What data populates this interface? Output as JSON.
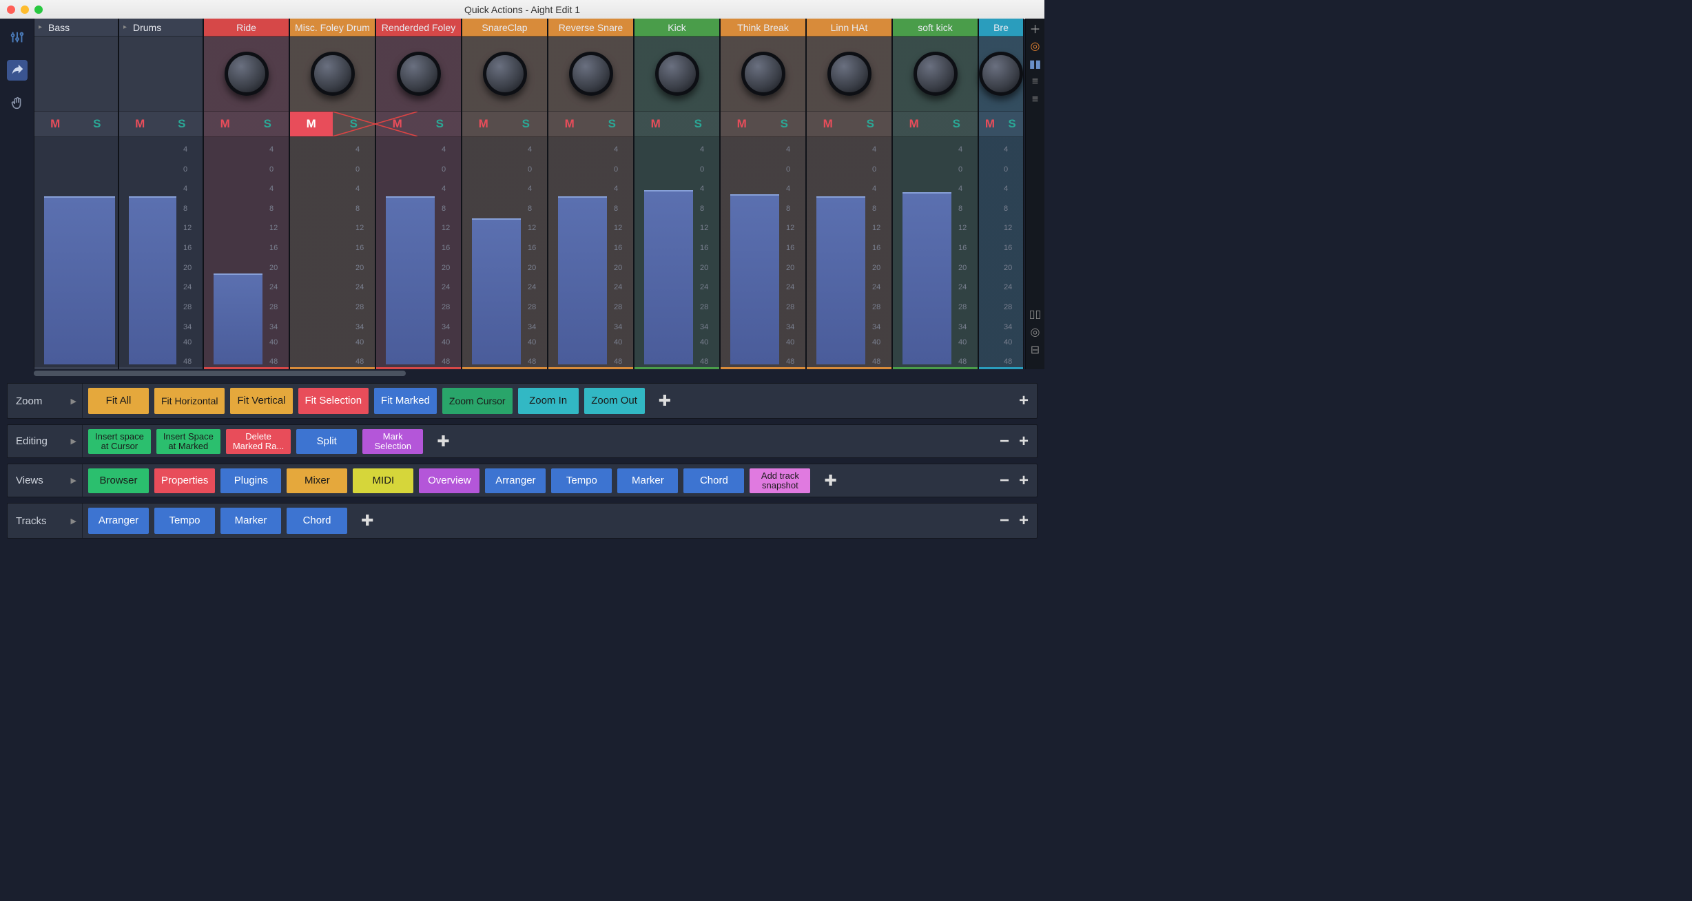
{
  "window": {
    "title": "Quick Actions - Aight Edit 1"
  },
  "meter_ticks": [
    "4",
    "0",
    "4",
    "8",
    "12",
    "16",
    "20",
    "24",
    "28",
    "34",
    "40",
    "48"
  ],
  "meter_tick_fractions": [
    0.0,
    0.09,
    0.18,
    0.27,
    0.36,
    0.45,
    0.54,
    0.63,
    0.72,
    0.81,
    0.88,
    0.97
  ],
  "channels": [
    {
      "name": "Bass",
      "type": "group",
      "color": "#3a4152",
      "mute": false,
      "solo": false,
      "level_frac": 0.76,
      "show_scale": false
    },
    {
      "name": "Drums",
      "type": "group",
      "color": "#3a4152",
      "mute": false,
      "solo": false,
      "level_frac": 0.76,
      "show_scale": true
    },
    {
      "name": "Ride",
      "color": "#d64848",
      "mute": false,
      "solo": false,
      "level_frac": 0.41,
      "show_scale": true
    },
    {
      "name": "Misc. Foley Drum",
      "color": "#d88b3a",
      "mute": true,
      "solo": false,
      "level_frac": 0.0,
      "show_scale": true,
      "xmark": true
    },
    {
      "name": "Renderded Foley",
      "color": "#d64848",
      "mute": false,
      "solo": false,
      "level_frac": 0.76,
      "show_scale": true
    },
    {
      "name": "SnareClap",
      "color": "#d88b3a",
      "mute": false,
      "solo": false,
      "level_frac": 0.66,
      "show_scale": true
    },
    {
      "name": "Reverse Snare",
      "color": "#d88b3a",
      "mute": false,
      "solo": false,
      "level_frac": 0.76,
      "show_scale": true
    },
    {
      "name": "Kick",
      "color": "#4a9d4a",
      "mute": false,
      "solo": false,
      "level_frac": 0.79,
      "show_scale": true
    },
    {
      "name": "Think Break",
      "color": "#d88b3a",
      "mute": false,
      "solo": false,
      "level_frac": 0.77,
      "show_scale": true
    },
    {
      "name": "Linn HAt",
      "color": "#d88b3a",
      "mute": false,
      "solo": false,
      "level_frac": 0.76,
      "show_scale": true
    },
    {
      "name": "soft kick",
      "color": "#4a9d4a",
      "mute": false,
      "solo": false,
      "level_frac": 0.78,
      "show_scale": true
    },
    {
      "name": "Bre",
      "color": "#2a9dbd",
      "mute": false,
      "solo": false,
      "level_frac": 0.0,
      "show_scale": true,
      "partial": true
    }
  ],
  "quick": {
    "zoom": {
      "label": "Zoom",
      "buttons": [
        {
          "label": "Fit All",
          "bg": "#e5a83c"
        },
        {
          "label": "Fit Horizontal",
          "bg": "#e5a83c",
          "sm": true
        },
        {
          "label": "Fit Vertical",
          "bg": "#e5a83c"
        },
        {
          "label": "Fit Selection",
          "bg": "#e84d5a",
          "fg": "#fff"
        },
        {
          "label": "Fit Marked",
          "bg": "#3d74d1",
          "fg": "#fff"
        },
        {
          "label": "Zoom Cursor",
          "bg": "#29a56a",
          "sm": true
        },
        {
          "label": "Zoom In",
          "bg": "#32b8c4"
        },
        {
          "label": "Zoom Out",
          "bg": "#32b8c4"
        }
      ],
      "plus": true,
      "end_plus": true,
      "end_minus": false
    },
    "editing": {
      "label": "Editing",
      "buttons": [
        {
          "label": "Insert space\nat Cursor",
          "bg": "#2bbf6e",
          "multi": true
        },
        {
          "label": "Insert Space\nat Marked",
          "bg": "#2bbf6e",
          "multi": true
        },
        {
          "label": "Delete\nMarked Ra...",
          "bg": "#e84d5a",
          "fg": "#fff",
          "multi": true
        },
        {
          "label": "Split",
          "bg": "#3d74d1",
          "fg": "#fff"
        },
        {
          "label": "Mark\nSelection",
          "bg": "#b456d9",
          "fg": "#fff",
          "multi": true
        }
      ],
      "plus": true,
      "end_plus": true,
      "end_minus": true
    },
    "views": {
      "label": "Views",
      "buttons": [
        {
          "label": "Browser",
          "bg": "#2bbf6e"
        },
        {
          "label": "Properties",
          "bg": "#e84d5a",
          "fg": "#fff"
        },
        {
          "label": "Plugins",
          "bg": "#3d74d1",
          "fg": "#fff"
        },
        {
          "label": "Mixer",
          "bg": "#e5a83c"
        },
        {
          "label": "MIDI",
          "bg": "#d6d63a"
        },
        {
          "label": "Overview",
          "bg": "#b456d9",
          "fg": "#fff"
        },
        {
          "label": "Arranger",
          "bg": "#3d74d1",
          "fg": "#fff"
        },
        {
          "label": "Tempo",
          "bg": "#3d74d1",
          "fg": "#fff"
        },
        {
          "label": "Marker",
          "bg": "#3d74d1",
          "fg": "#fff"
        },
        {
          "label": "Chord",
          "bg": "#3d74d1",
          "fg": "#fff"
        },
        {
          "label": "Add track\nsnapshot",
          "bg": "#e07ae0",
          "multi": true
        }
      ],
      "plus": true,
      "end_plus": true,
      "end_minus": true
    },
    "tracks": {
      "label": "Tracks",
      "buttons": [
        {
          "label": "Arranger",
          "bg": "#3d74d1",
          "fg": "#fff"
        },
        {
          "label": "Tempo",
          "bg": "#3d74d1",
          "fg": "#fff"
        },
        {
          "label": "Marker",
          "bg": "#3d74d1",
          "fg": "#fff"
        },
        {
          "label": "Chord",
          "bg": "#3d74d1",
          "fg": "#fff"
        }
      ],
      "plus": true,
      "end_plus": true,
      "end_minus": true
    }
  }
}
